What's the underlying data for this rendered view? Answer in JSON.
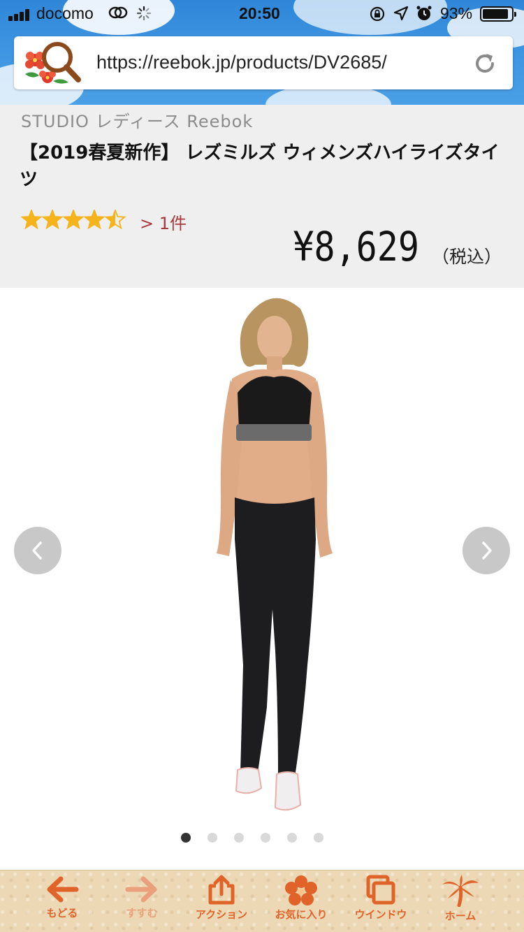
{
  "status_bar": {
    "carrier": "docomo",
    "time": "20:50",
    "battery": "93%"
  },
  "browser": {
    "url": "https://reebok.jp/products/DV2685/"
  },
  "product": {
    "brand_line": "STUDIO レディース Reebok",
    "title": "【2019春夏新作】 レズミルズ ウィメンズハイライズタイツ",
    "rating": 4.5,
    "rating_max": 5,
    "review_count": "> 1件",
    "price": "¥8,629",
    "tax_note": "（税込）"
  },
  "carousel": {
    "image_count": 6,
    "active_index": 0
  },
  "toolbar": {
    "back": "もどる",
    "forward": "すすむ",
    "action": "アクション",
    "favorites": "お気に入り",
    "window": "ウインドウ",
    "home": "ホーム"
  },
  "colors": {
    "accent": "#e0642a",
    "star": "#f5b31c",
    "review_link": "#a7393b",
    "sky": "#3c93e0"
  }
}
